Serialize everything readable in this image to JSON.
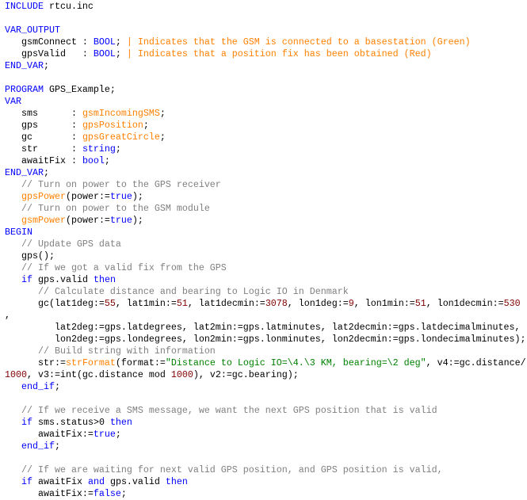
{
  "colors": {
    "keyword": "#0000ff",
    "function_type": "#ff8000",
    "comment": "#808080",
    "number": "#800000",
    "string": "#008000",
    "text": "#000000"
  },
  "lines": [
    [
      [
        "k",
        "INCLUDE"
      ],
      [
        "t",
        " rtcu.inc"
      ]
    ],
    [],
    [
      [
        "k",
        "VAR_OUTPUT"
      ]
    ],
    [
      [
        "t",
        "   gsmConnect : "
      ],
      [
        "k",
        "BOOL"
      ],
      [
        "t",
        "; "
      ],
      [
        "o",
        "| Indicates that the GSM is connected to a basestation (Green)"
      ]
    ],
    [
      [
        "t",
        "   gpsValid   : "
      ],
      [
        "k",
        "BOOL"
      ],
      [
        "t",
        "; "
      ],
      [
        "o",
        "| Indicates that a position fix has been obtained (Red)"
      ]
    ],
    [
      [
        "k",
        "END_VAR"
      ],
      [
        "t",
        ";"
      ]
    ],
    [],
    [
      [
        "k",
        "PROGRAM"
      ],
      [
        "t",
        " GPS_Example;"
      ]
    ],
    [
      [
        "k",
        "VAR"
      ]
    ],
    [
      [
        "t",
        "   sms      : "
      ],
      [
        "o",
        "gsmIncomingSMS"
      ],
      [
        "t",
        ";"
      ]
    ],
    [
      [
        "t",
        "   gps      : "
      ],
      [
        "o",
        "gpsPosition"
      ],
      [
        "t",
        ";"
      ]
    ],
    [
      [
        "t",
        "   gc       : "
      ],
      [
        "o",
        "gpsGreatCircle"
      ],
      [
        "t",
        ";"
      ]
    ],
    [
      [
        "t",
        "   str      : "
      ],
      [
        "k",
        "string"
      ],
      [
        "t",
        ";"
      ]
    ],
    [
      [
        "t",
        "   awaitFix : "
      ],
      [
        "k",
        "bool"
      ],
      [
        "t",
        ";"
      ]
    ],
    [
      [
        "k",
        "END_VAR"
      ],
      [
        "t",
        ";"
      ]
    ],
    [
      [
        "c",
        "   // Turn on power to the GPS receiver"
      ]
    ],
    [
      [
        "t",
        "   "
      ],
      [
        "o",
        "gpsPower"
      ],
      [
        "t",
        "(power:="
      ],
      [
        "k",
        "true"
      ],
      [
        "t",
        ");"
      ]
    ],
    [
      [
        "c",
        "   // Turn on power to the GSM module"
      ]
    ],
    [
      [
        "t",
        "   "
      ],
      [
        "o",
        "gsmPower"
      ],
      [
        "t",
        "(power:="
      ],
      [
        "k",
        "true"
      ],
      [
        "t",
        ");"
      ]
    ],
    [
      [
        "k",
        "BEGIN"
      ]
    ],
    [
      [
        "c",
        "   // Update GPS data"
      ]
    ],
    [
      [
        "t",
        "   gps();"
      ]
    ],
    [
      [
        "c",
        "   // If we got a valid fix from the GPS"
      ]
    ],
    [
      [
        "t",
        "   "
      ],
      [
        "k",
        "if"
      ],
      [
        "t",
        " gps.valid "
      ],
      [
        "k",
        "then"
      ]
    ],
    [
      [
        "c",
        "      // Calculate distance and bearing to Logic IO in Denmark"
      ]
    ],
    [
      [
        "t",
        "      gc(lat1deg:="
      ],
      [
        "n",
        "55"
      ],
      [
        "t",
        ", lat1min:="
      ],
      [
        "n",
        "51"
      ],
      [
        "t",
        ", lat1decmin:="
      ],
      [
        "n",
        "3078"
      ],
      [
        "t",
        ", lon1deg:="
      ],
      [
        "n",
        "9"
      ],
      [
        "t",
        ", lon1min:="
      ],
      [
        "n",
        "51"
      ],
      [
        "t",
        ", lon1decmin:="
      ],
      [
        "n",
        "530"
      ]
    ],
    [
      [
        "t",
        ","
      ]
    ],
    [
      [
        "t",
        "         lat2deg:=gps.latdegrees, lat2min:=gps.latminutes, lat2decmin:=gps.latdecimalminutes,"
      ]
    ],
    [
      [
        "t",
        "         lon2deg:=gps.londegrees, lon2min:=gps.lonminutes, lon2decmin:=gps.londecimalminutes);"
      ]
    ],
    [
      [
        "c",
        "      // Build string with information"
      ]
    ],
    [
      [
        "t",
        "      str:="
      ],
      [
        "o",
        "strFormat"
      ],
      [
        "t",
        "(format:="
      ],
      [
        "s",
        "\"Distance to Logic IO=\\4.\\3 KM, bearing=\\2 deg\""
      ],
      [
        "t",
        ", v4:=gc.distance/"
      ]
    ],
    [
      [
        "n",
        "1000"
      ],
      [
        "t",
        ", v3:=int(gc.distance mod "
      ],
      [
        "n",
        "1000"
      ],
      [
        "t",
        "), v2:=gc.bearing);"
      ]
    ],
    [
      [
        "t",
        "   "
      ],
      [
        "k",
        "end_if"
      ],
      [
        "t",
        ";"
      ]
    ],
    [],
    [
      [
        "c",
        "   // If we receive a SMS message, we want the next GPS position that is valid"
      ]
    ],
    [
      [
        "t",
        "   "
      ],
      [
        "k",
        "if"
      ],
      [
        "t",
        " sms.status>0 "
      ],
      [
        "k",
        "then"
      ]
    ],
    [
      [
        "t",
        "      awaitFix:="
      ],
      [
        "k",
        "true"
      ],
      [
        "t",
        ";"
      ]
    ],
    [
      [
        "t",
        "   "
      ],
      [
        "k",
        "end_if"
      ],
      [
        "t",
        ";"
      ]
    ],
    [],
    [
      [
        "c",
        "   // If we are waiting for next valid GPS position, and GPS position is valid,"
      ]
    ],
    [
      [
        "t",
        "   "
      ],
      [
        "k",
        "if"
      ],
      [
        "t",
        " awaitFix "
      ],
      [
        "k",
        "and"
      ],
      [
        "t",
        " gps.valid "
      ],
      [
        "k",
        "then"
      ]
    ],
    [
      [
        "t",
        "      awaitFix:="
      ],
      [
        "k",
        "false"
      ],
      [
        "t",
        ";"
      ]
    ]
  ]
}
